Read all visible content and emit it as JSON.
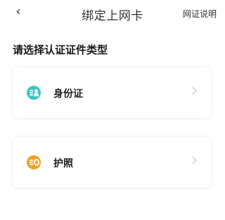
{
  "header": {
    "back_icon": "chevron-left-icon",
    "title": "绑定上网卡",
    "help_label": "网证说明"
  },
  "section": {
    "title": "请选择认证证件类型"
  },
  "options": [
    {
      "label": "身份证",
      "icon": "id-card-icon",
      "color": "#3cc8c8"
    },
    {
      "label": "护照",
      "icon": "passport-icon",
      "color": "#f5a21e"
    }
  ]
}
